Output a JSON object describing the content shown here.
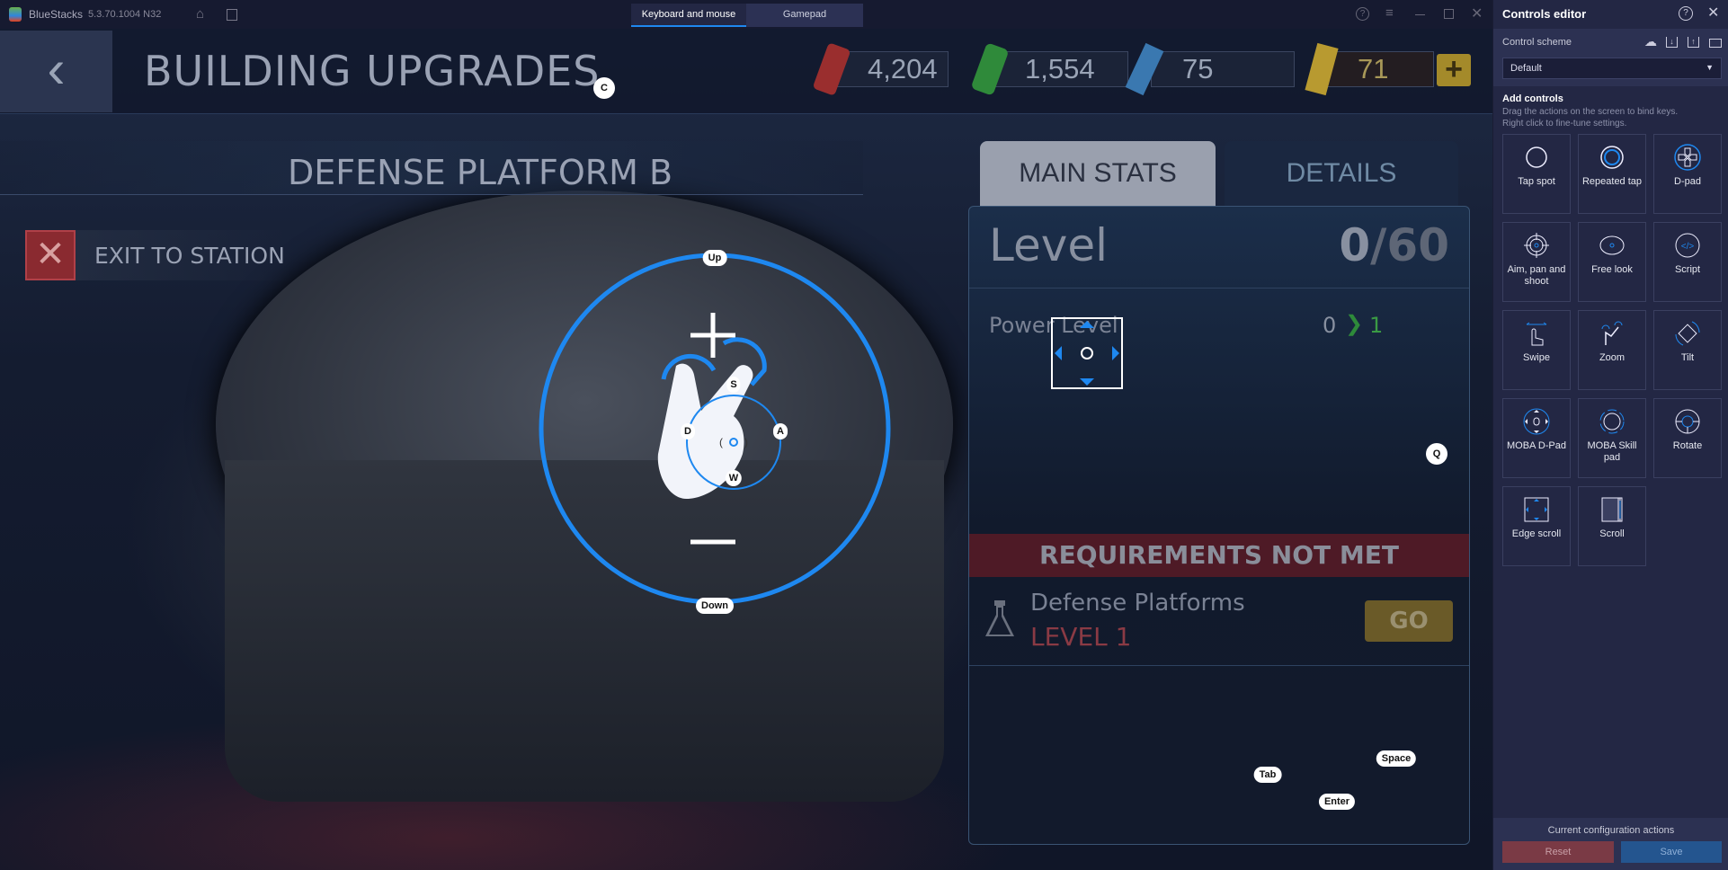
{
  "titlebar": {
    "app": "BlueStacks",
    "version": "5.3.70.1004 N32",
    "tabs": [
      "Keyboard and mouse",
      "Gamepad"
    ],
    "active_tab": "Keyboard and mouse"
  },
  "game": {
    "title": "BUILDING UPGRADES",
    "resources": [
      {
        "name": "red-resource",
        "value": "4,204"
      },
      {
        "name": "green-resource",
        "value": "1,554"
      },
      {
        "name": "blue-resource",
        "value": "75"
      },
      {
        "name": "gold-resource",
        "value": "71"
      }
    ],
    "add_label": "+",
    "building": "DEFENSE PLATFORM B",
    "exit": "EXIT TO STATION",
    "tabs": [
      "MAIN STATS",
      "DETAILS"
    ],
    "level_label": "Level",
    "level_current": "0",
    "level_max": "/60",
    "stat_label": "Power Level",
    "stat_from": "0",
    "stat_arrow": "❯",
    "stat_to": "1",
    "requirements": "REQUIREMENTS NOT MET",
    "req_name": "Defense Platforms",
    "req_level": "LEVEL 1",
    "go": "GO"
  },
  "overlay_keys": {
    "tap": "C",
    "zoom_up": "Up",
    "zoom_down": "Down",
    "up": "S",
    "left": "D",
    "right": "A",
    "down": "W",
    "q": "Q",
    "tab": "Tab",
    "enter": "Enter",
    "space": "Space"
  },
  "editor": {
    "title": "Controls editor",
    "scheme_label": "Control scheme",
    "scheme_value": "Default",
    "add_title": "Add controls",
    "add_desc1": "Drag the actions on the screen to bind keys.",
    "add_desc2": "Right click to fine-tune settings.",
    "controls": [
      {
        "label": "Tap spot",
        "icon": "tap"
      },
      {
        "label": "Repeated tap",
        "icon": "repeat"
      },
      {
        "label": "D-pad",
        "icon": "dpad"
      },
      {
        "label": "Aim, pan and shoot",
        "icon": "aim"
      },
      {
        "label": "Free look",
        "icon": "eye"
      },
      {
        "label": "Script",
        "icon": "script"
      },
      {
        "label": "Swipe",
        "icon": "swipe"
      },
      {
        "label": "Zoom",
        "icon": "zoom"
      },
      {
        "label": "Tilt",
        "icon": "tilt"
      },
      {
        "label": "MOBA D-Pad",
        "icon": "mobadpad"
      },
      {
        "label": "MOBA Skill pad",
        "icon": "skill"
      },
      {
        "label": "Rotate",
        "icon": "rotate"
      },
      {
        "label": "Edge scroll",
        "icon": "edge"
      },
      {
        "label": "Scroll",
        "icon": "scroll"
      }
    ],
    "footer_label": "Current configuration actions",
    "reset": "Reset",
    "save": "Save"
  },
  "colors": {
    "accent": "#1e88f0",
    "reset": "#7a3a45",
    "save": "#24558f",
    "panel": "#232744"
  }
}
